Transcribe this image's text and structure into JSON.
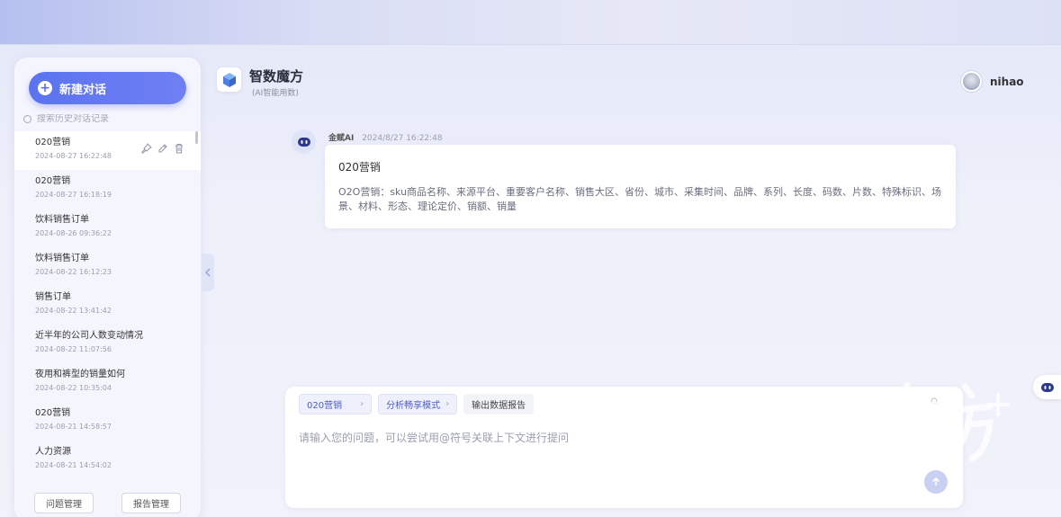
{
  "app": {
    "title": "智数魔方",
    "subtitle": "(AI智能用数)"
  },
  "sidebar": {
    "new_chat_label": "新建对话",
    "search_placeholder": "搜索历史对话记录",
    "history": [
      {
        "title": "020营销",
        "time": "2024-08-27 16:22:48"
      },
      {
        "title": "020营销",
        "time": "2024-08-27 16:18:19"
      },
      {
        "title": "饮料销售订单",
        "time": "2024-08-26 09:36:22"
      },
      {
        "title": "饮料销售订单",
        "time": "2024-08-22 16:12:23"
      },
      {
        "title": "销售订单",
        "time": "2024-08-22 13:41:42"
      },
      {
        "title": "近半年的公司人数变动情况",
        "time": "2024-08-22 11:07:56"
      },
      {
        "title": "夜用和裤型的销量如何",
        "time": "2024-08-22 10:35:04"
      },
      {
        "title": "020营销",
        "time": "2024-08-21 14:58:57"
      },
      {
        "title": "人力资源",
        "time": "2024-08-21 14:54:02"
      }
    ],
    "question_mgmt_label": "问题管理",
    "report_mgmt_label": "报告管理"
  },
  "user": {
    "name": "nihao"
  },
  "message": {
    "sender": "金赋AI",
    "time": "2024/8/27 16:22:48",
    "title": "020营销",
    "body": "O2O营销：sku商品名称、来源平台、重要客户名称、销售大区、省份、城市、采集时间、品牌、系列、长度、码数、片数、特殊标识、场景、材料、形态、理论定价、销额、销量"
  },
  "input": {
    "chips": [
      {
        "label": "020营销"
      },
      {
        "label": "分析畅享模式"
      },
      {
        "label": "输出数据报告"
      }
    ],
    "placeholder": "请输入您的问题，可以尝试用@符号关联上下文进行提问"
  },
  "colors": {
    "accent": "#5b73f0",
    "chip_text": "#4f5cc8"
  },
  "icons": [
    "plus-icon",
    "search-icon",
    "pin-icon",
    "edit-icon",
    "trash-icon",
    "chevron-left-icon",
    "cube-logo-icon",
    "robot-icon",
    "send-icon",
    "chevron-right-icon"
  ]
}
